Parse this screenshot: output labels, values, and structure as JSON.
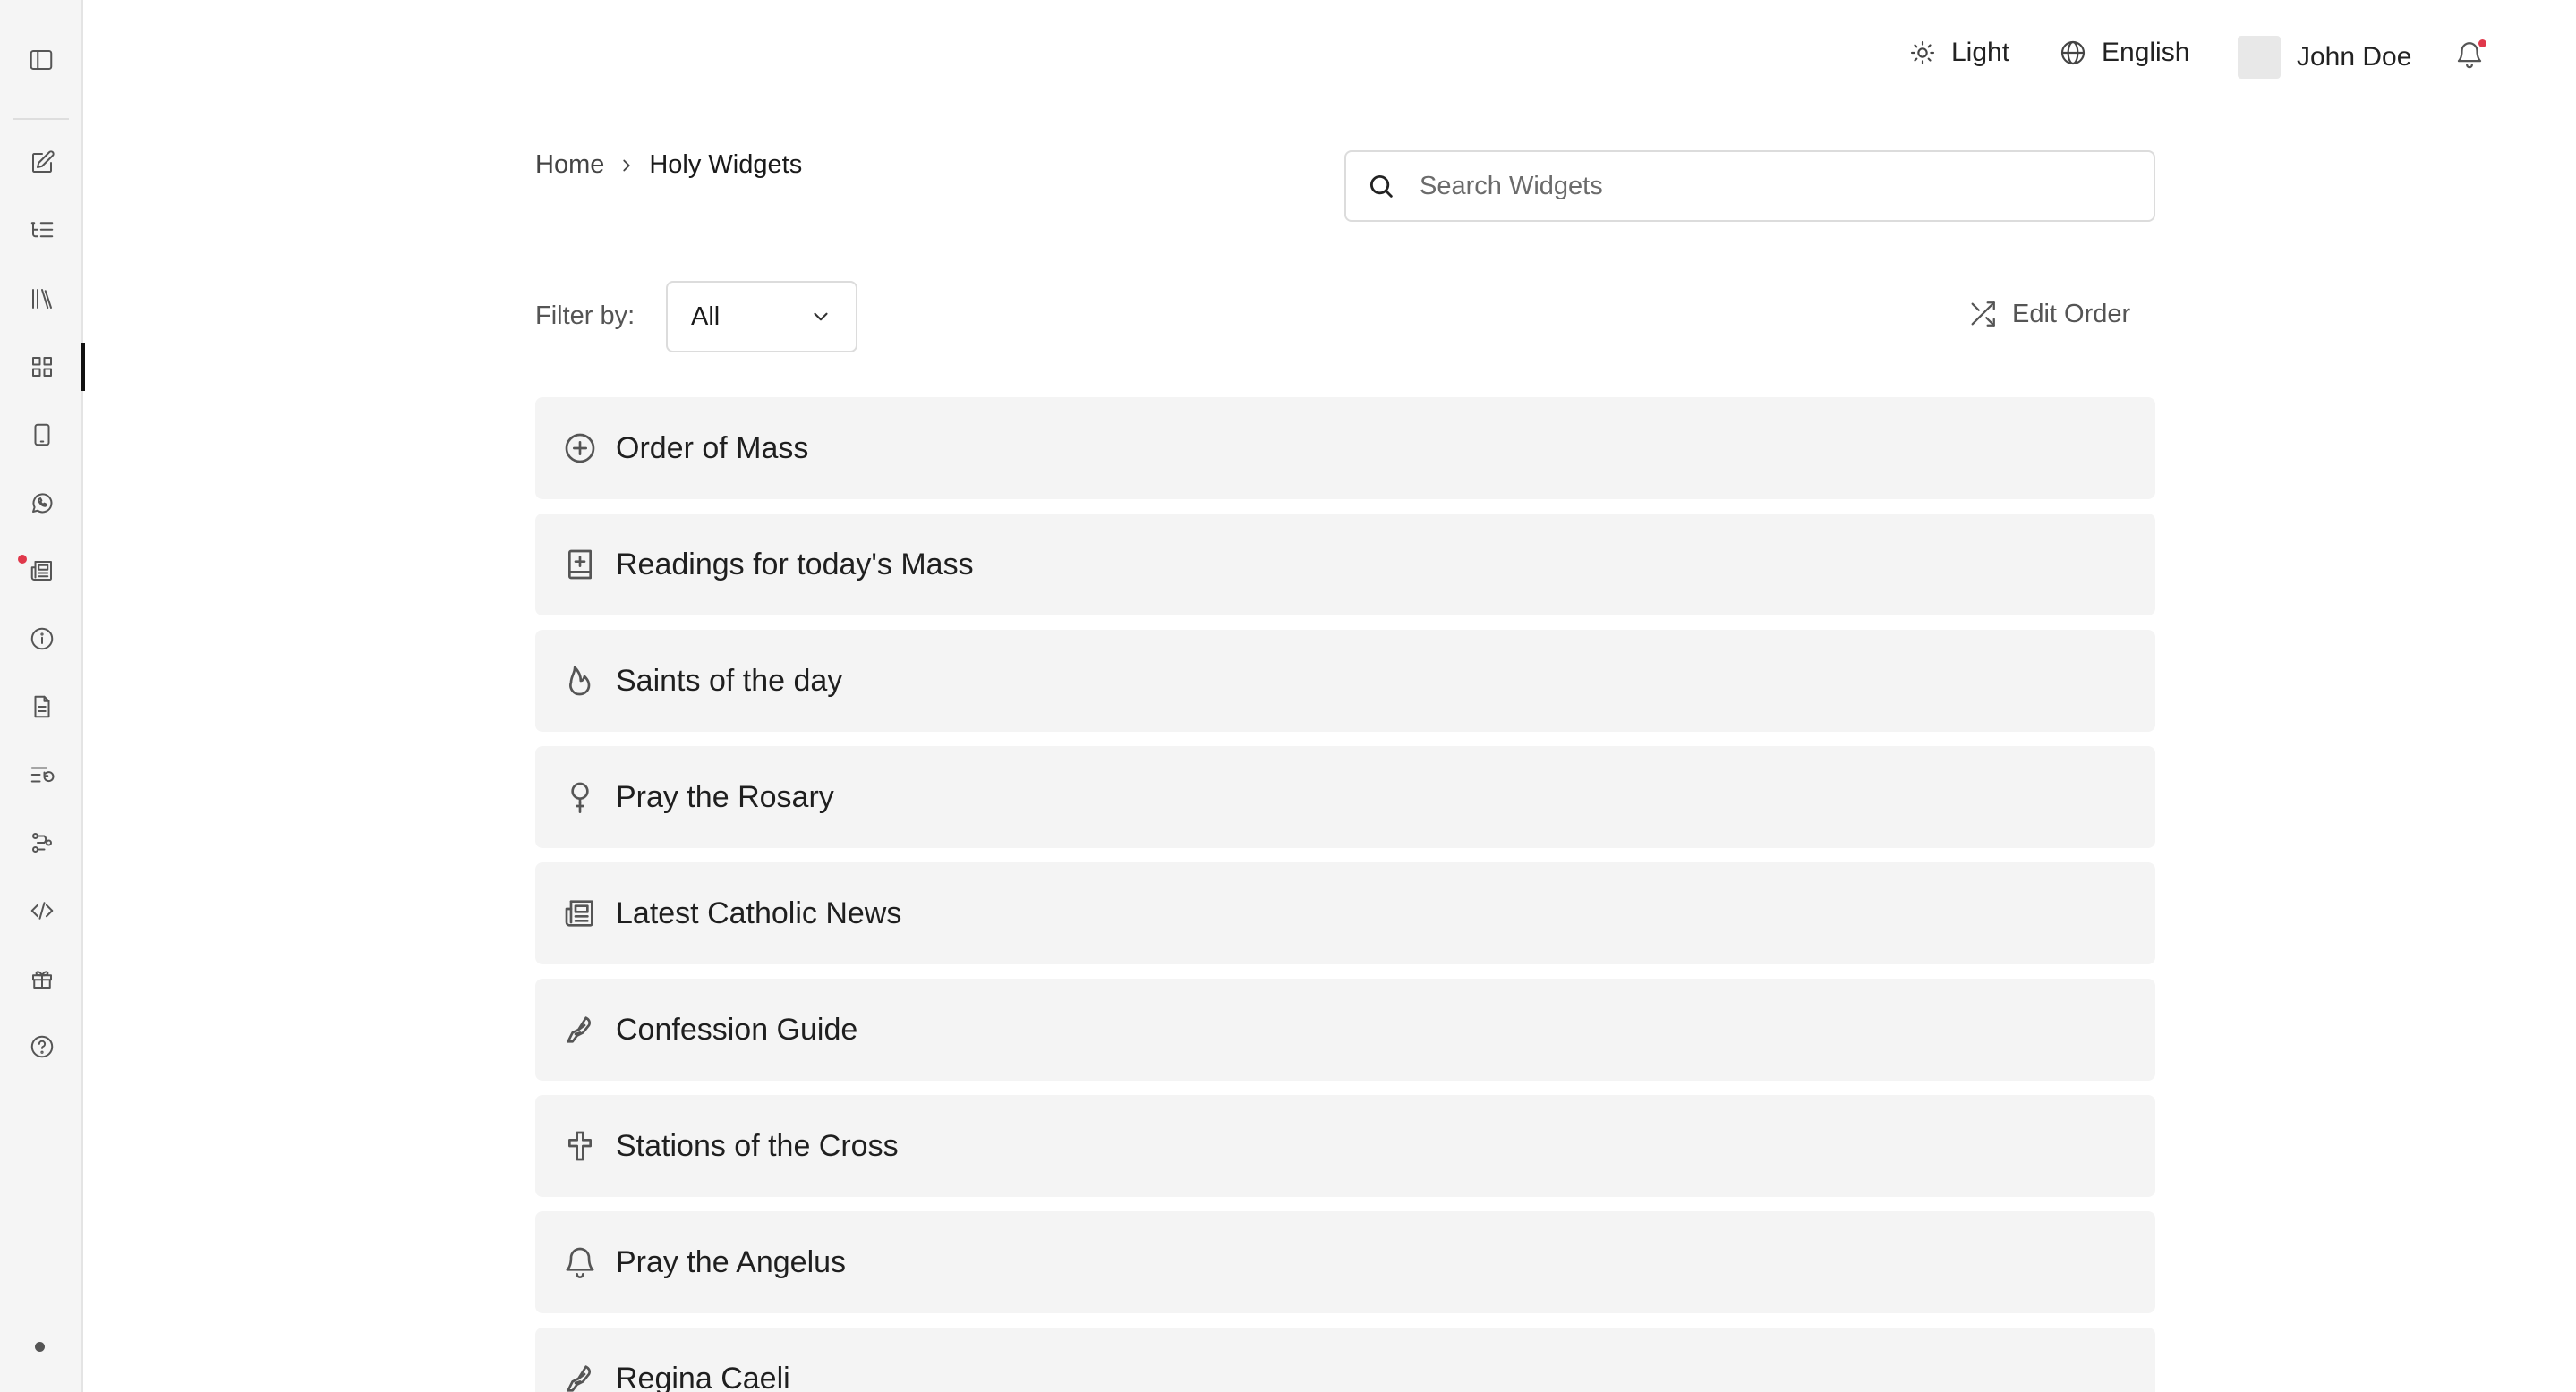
{
  "sidebar": {
    "items": [
      {
        "icon": "edit-icon",
        "name": "sidebar-item-editor"
      },
      {
        "icon": "list-tree-icon",
        "name": "sidebar-item-outline"
      },
      {
        "icon": "library-icon",
        "name": "sidebar-item-library"
      },
      {
        "icon": "grid-icon",
        "name": "sidebar-item-widgets",
        "active": true
      },
      {
        "icon": "tablet-icon",
        "name": "sidebar-item-device"
      },
      {
        "icon": "whatsapp-icon",
        "name": "sidebar-item-whatsapp"
      },
      {
        "icon": "newspaper-icon",
        "name": "sidebar-item-news",
        "badge": true
      },
      {
        "icon": "info-icon",
        "name": "sidebar-item-info"
      },
      {
        "icon": "document-icon",
        "name": "sidebar-item-documents"
      },
      {
        "icon": "list-restart-icon",
        "name": "sidebar-item-history"
      },
      {
        "icon": "workflow-icon",
        "name": "sidebar-item-workflow"
      },
      {
        "icon": "code-icon",
        "name": "sidebar-item-code"
      },
      {
        "icon": "gift-icon",
        "name": "sidebar-item-gifts"
      },
      {
        "icon": "help-icon",
        "name": "sidebar-item-help"
      }
    ]
  },
  "header": {
    "theme_label": "Light",
    "language_label": "English",
    "user_name": "John Doe"
  },
  "breadcrumb": {
    "home": "Home",
    "current": "Holy Widgets"
  },
  "search": {
    "placeholder": "Search Widgets"
  },
  "filter": {
    "label": "Filter by:",
    "selected": "All"
  },
  "toolbar": {
    "edit_order_label": "Edit Order"
  },
  "widgets": [
    {
      "label": "Order of Mass",
      "icon": "plus-circle-icon"
    },
    {
      "label": "Readings for today's Mass",
      "icon": "book-plus-icon"
    },
    {
      "label": "Saints of the day",
      "icon": "flame-icon"
    },
    {
      "label": "Pray the Rosary",
      "icon": "rosary-icon"
    },
    {
      "label": "Latest Catholic News",
      "icon": "newspaper-icon"
    },
    {
      "label": "Confession Guide",
      "icon": "feather-hand-icon"
    },
    {
      "label": "Stations of the Cross",
      "icon": "cross-icon"
    },
    {
      "label": "Pray the Angelus",
      "icon": "bell-icon"
    },
    {
      "label": "Regina Caeli",
      "icon": "feather-hand-icon"
    }
  ],
  "colors": {
    "sidebar_bg": "#f5f5f5",
    "card_bg": "#f4f4f4",
    "notification_dot": "#e0384b",
    "active_indicator": "#111111"
  }
}
